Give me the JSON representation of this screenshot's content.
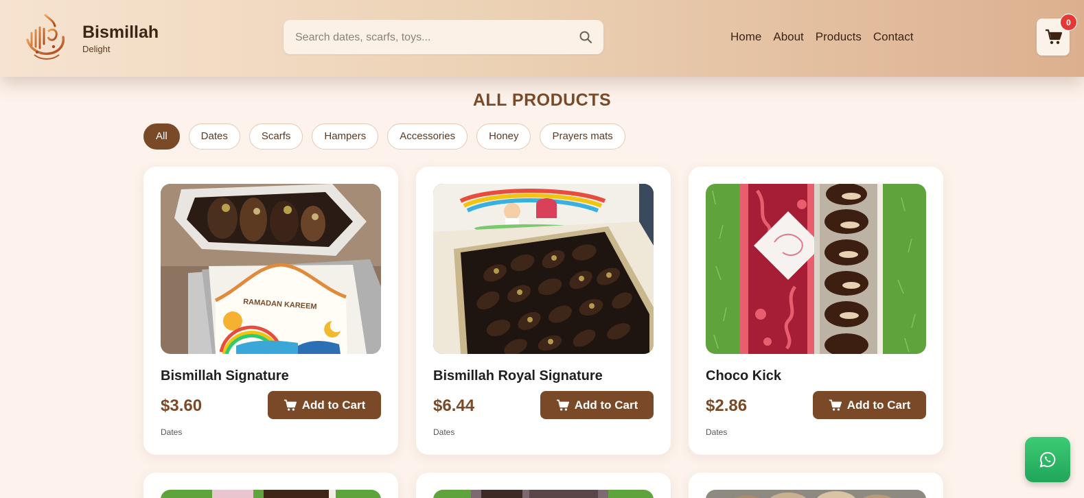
{
  "header": {
    "brand_name": "Bismillah",
    "brand_sub": "Delight",
    "logo_icon": "arabic-calligraphy-logo-icon",
    "search_placeholder": "Search dates, scarfs, toys...",
    "search_icon": "search-icon",
    "nav": [
      "Home",
      "About",
      "Products",
      "Contact"
    ],
    "cart_count": "0",
    "cart_icon": "cart-icon"
  },
  "section": {
    "title": "ALL PRODUCTS",
    "filters": [
      "All",
      "Dates",
      "Scarfs",
      "Hampers",
      "Accessories",
      "Honey",
      "Prayers mats"
    ],
    "active_filter": "All"
  },
  "products": [
    {
      "name": "Bismillah Signature",
      "price": "$3.60",
      "category": "Dates",
      "button": "Add to Cart"
    },
    {
      "name": "Bismillah Royal Signature",
      "price": "$6.44",
      "category": "Dates",
      "button": "Add to Cart"
    },
    {
      "name": "Choco Kick",
      "price": "$2.86",
      "category": "Dates",
      "button": "Add to Cart"
    }
  ],
  "whatsapp_icon": "whatsapp-icon",
  "colors": {
    "accent": "#7a4a28",
    "badge": "#e53935",
    "whatsapp": "#25b25f",
    "background": "#fdf3ec"
  }
}
